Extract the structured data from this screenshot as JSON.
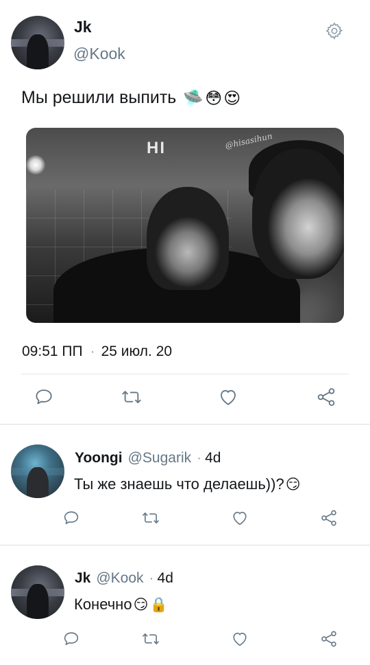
{
  "main_tweet": {
    "author_name": "Jk",
    "author_handle": "@Kook",
    "text": "Мы решили выпить",
    "emojis": [
      "🛸",
      "😳",
      "😍"
    ],
    "photo": {
      "watermark": "@hisasihun",
      "sign_text": "HI"
    },
    "time": "09:51 ПП",
    "date": "25 июл. 20"
  },
  "replies": [
    {
      "author_name": "Yoongi",
      "author_handle": "@Sugarik",
      "age": "4d",
      "text": "Ты же знаешь что делаешь))?",
      "emojis": [
        "😏"
      ]
    },
    {
      "author_name": "Jk",
      "author_handle": "@Kook",
      "age": "4d",
      "text": "Конечно",
      "emojis": [
        "😏",
        "🔒"
      ]
    }
  ],
  "icons": {
    "settings": "gear-icon",
    "reply": "comment-icon",
    "retweet": "retweet-icon",
    "like": "heart-icon",
    "share": "share-icon"
  },
  "colors": {
    "icon_gray": "#657786",
    "divider": "#e1e6ea",
    "text": "#14171a"
  }
}
